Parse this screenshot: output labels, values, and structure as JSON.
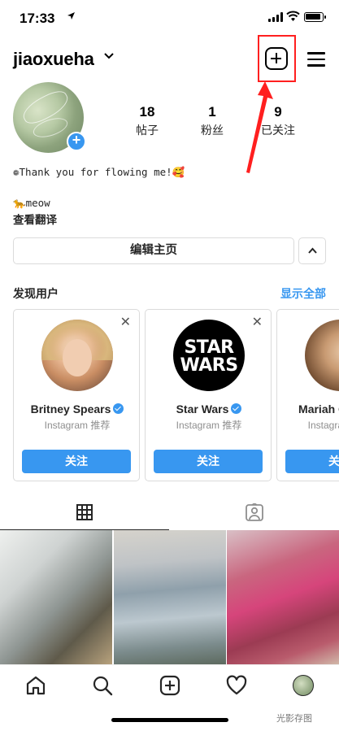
{
  "status_bar": {
    "time": "17:33",
    "location_icon": "location-arrow-icon",
    "signal_icon": "cellular-signal-icon",
    "wifi_icon": "wifi-icon",
    "battery_icon": "battery-icon"
  },
  "header": {
    "username": "jiaoxueha",
    "new_post_icon": "plus-square-icon",
    "menu_icon": "hamburger-menu-icon"
  },
  "profile": {
    "stats": [
      {
        "value": "18",
        "label": "帖子"
      },
      {
        "value": "1",
        "label": "粉丝"
      },
      {
        "value": "9",
        "label": "已关注"
      }
    ],
    "bio_line1": "❁Thank you for flowing me!🥰",
    "bio_line2": "🐆meow",
    "translate_label": "查看翻译",
    "edit_button_label": "编辑主页"
  },
  "discover": {
    "title": "发现用户",
    "see_all": "显示全部",
    "cards": [
      {
        "name": "Britney Spears",
        "verified": true,
        "subtitle": "Instagram 推荐",
        "follow_label": "关注"
      },
      {
        "name": "Star Wars",
        "verified": true,
        "subtitle": "Instagram 推荐",
        "follow_label": "关注",
        "avatar_text": [
          "STAR",
          "WARS"
        ]
      },
      {
        "name": "Mariah Carey",
        "verified": true,
        "subtitle": "Instagram 推荐",
        "follow_label": "关注"
      }
    ]
  },
  "tabs": [
    {
      "icon": "grid-icon",
      "active": true
    },
    {
      "icon": "tagged-person-icon",
      "active": false
    }
  ],
  "bottom_nav": [
    "home-icon",
    "search-icon",
    "new-post-icon",
    "heart-icon",
    "profile-avatar"
  ],
  "watermark": "光影存图",
  "colors": {
    "accent": "#3897f0",
    "annotation": "#ff1f1f",
    "text": "#262626",
    "border": "#dbdbdb"
  }
}
